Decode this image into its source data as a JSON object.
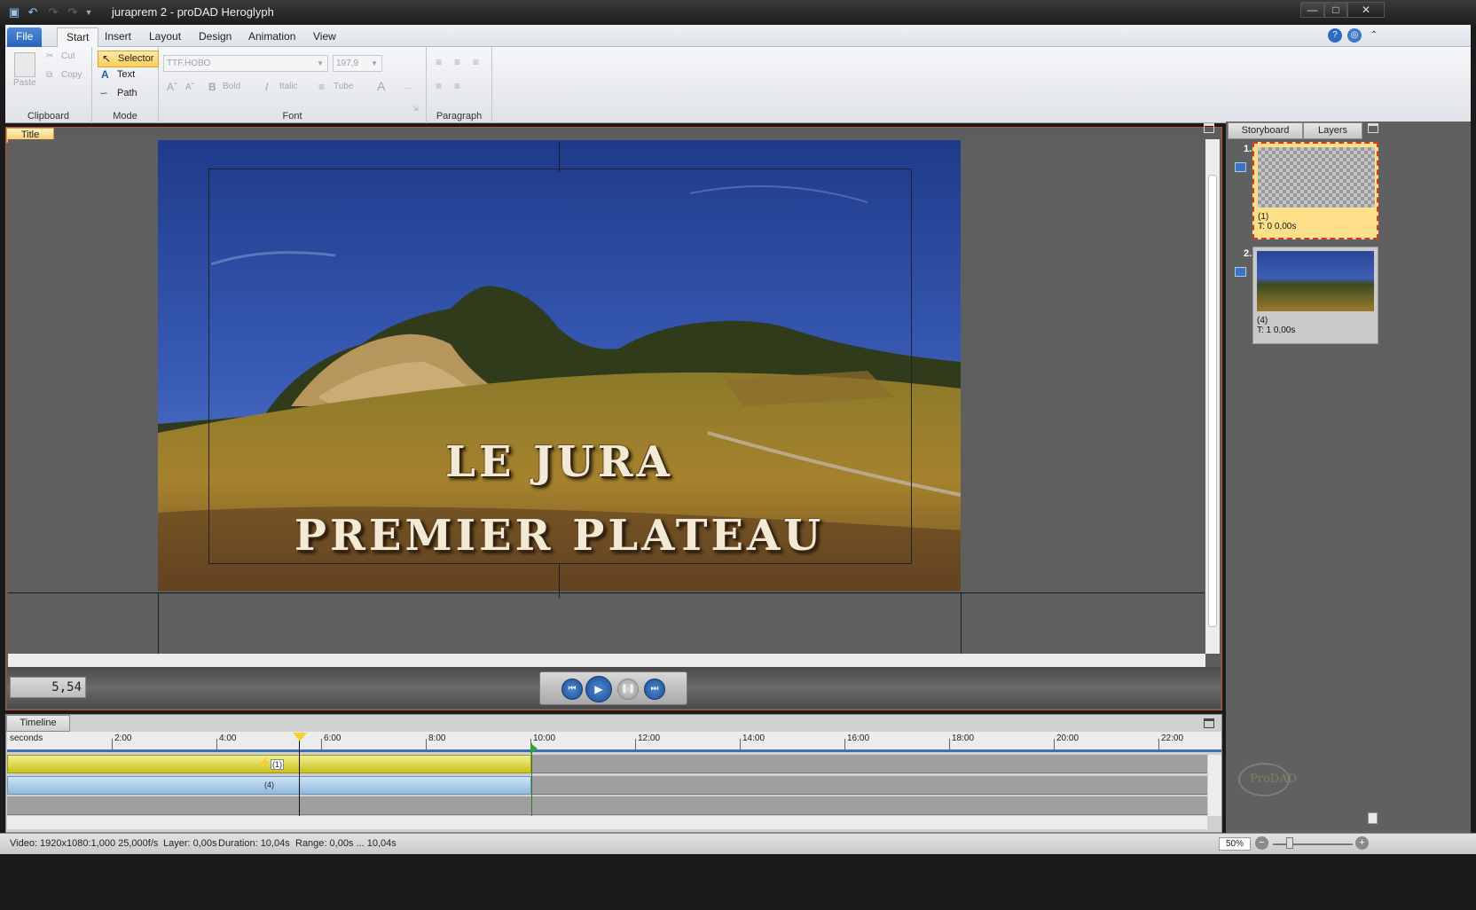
{
  "window": {
    "title": "juraprem 2 - proDAD Heroglyph"
  },
  "menu": {
    "tabs": [
      "File",
      "Start",
      "Insert",
      "Layout",
      "Design",
      "Animation",
      "View"
    ]
  },
  "ribbon": {
    "clipboard": {
      "label": "Clipboard",
      "paste": "Paste",
      "cut": "Cut",
      "copy": "Copy"
    },
    "mode": {
      "label": "Mode",
      "selector": "Selector",
      "text": "Text",
      "path": "Path"
    },
    "font": {
      "label": "Font",
      "family": "TTF.HOBO",
      "size": "197,9",
      "bold": "Bold",
      "italic": "Italic",
      "tube": "Tube",
      "more": "..."
    },
    "paragraph": {
      "label": "Paragraph"
    }
  },
  "title_panel": {
    "tab": "Title",
    "line1": "LE JURA",
    "line2": "PREMIER PLATEAU",
    "timecode": "5,54"
  },
  "right_pane": {
    "tabs": [
      "Storyboard",
      "Layers"
    ],
    "items": [
      {
        "num": "1.",
        "label": "(1)",
        "time": "T: 0  0,00s"
      },
      {
        "num": "2.",
        "label": "(4)",
        "time": "T: 1  0,00s"
      }
    ],
    "watermark": "ProDAD"
  },
  "timeline": {
    "tab": "Timeline",
    "units": "seconds",
    "ticks": [
      "2:00",
      "4:00",
      "6:00",
      "8:00",
      "10:00",
      "12:00",
      "14:00",
      "16:00",
      "18:00",
      "20:00",
      "22:00"
    ],
    "clips": [
      {
        "label": "(1)",
        "color": "#d8d23a"
      },
      {
        "label": "(4)",
        "color": "#a9c9e6"
      }
    ]
  },
  "status": {
    "video": "Video: 1920x1080:1,000  25,000f/s",
    "layer": "Layer: 0,00s",
    "duration": "Duration: 10,04s",
    "range": "Range: 0,00s ... 10,04s",
    "zoom": "50%"
  },
  "colors": {
    "accent": "#2962b7",
    "panel_border": "#c0503a",
    "selection": "#ffcf5a"
  }
}
